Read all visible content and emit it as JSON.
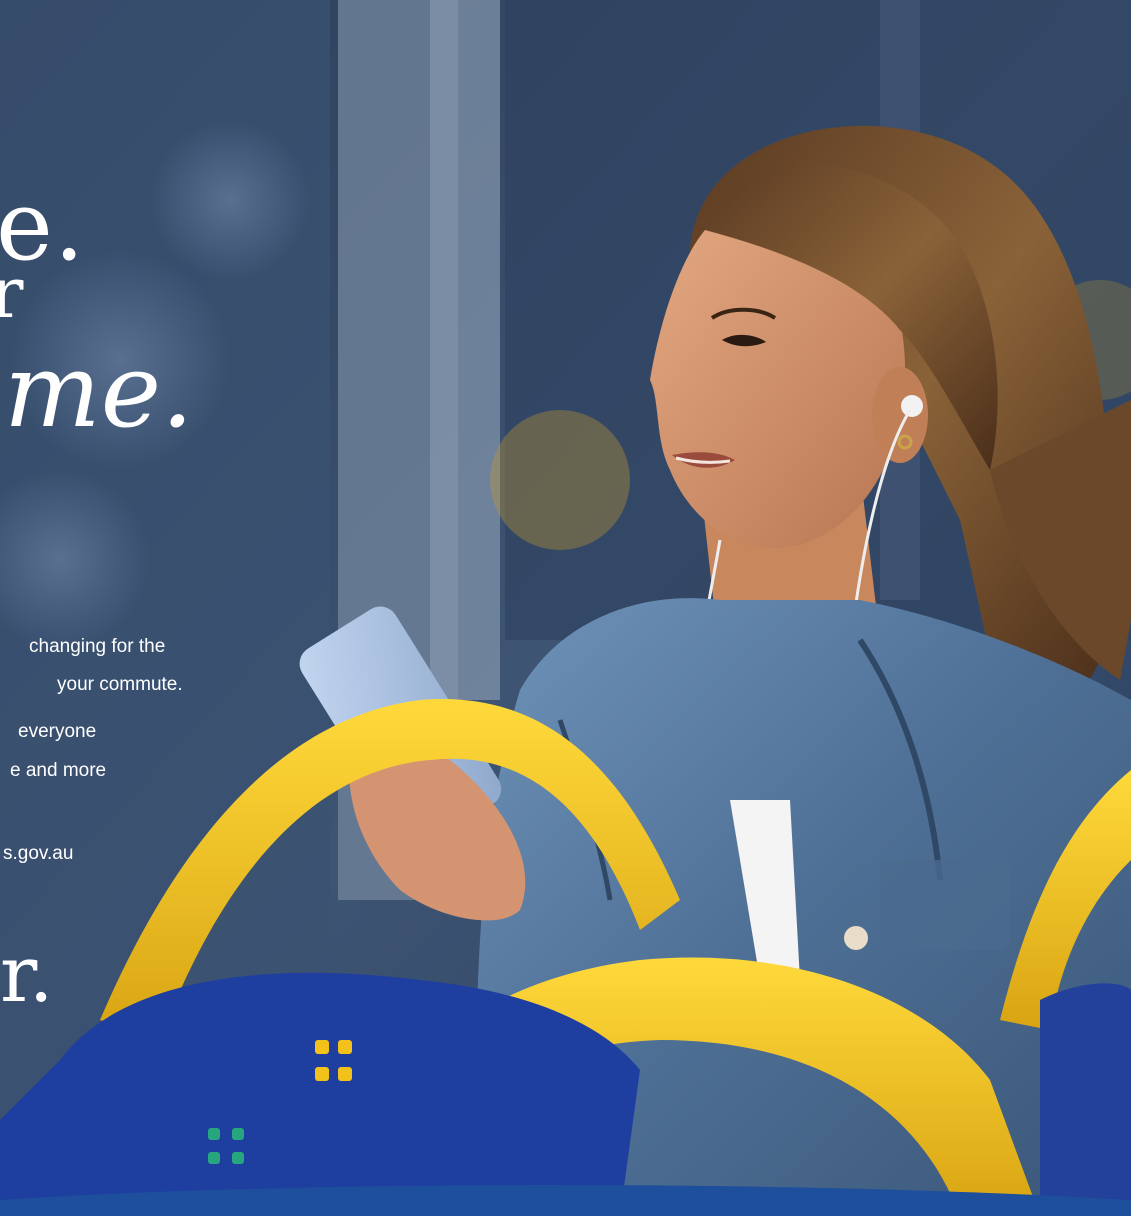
{
  "poster": {
    "headline": {
      "line1": "e.",
      "line2": "r",
      "line3": "me."
    },
    "body_text": {
      "line1": "changing for the",
      "line2": "your commute.",
      "line3": "everyone",
      "line4": "e and more",
      "line5": "s.gov.au"
    },
    "footer_fragment": "r."
  },
  "colors": {
    "seat_yellow": "#f2c21a",
    "seat_fabric_blue": "#1f3fa0",
    "window_blue": "#3a4f6f",
    "footer_band_blue": "#1d4f9c",
    "denim": "#5a7fa6"
  }
}
